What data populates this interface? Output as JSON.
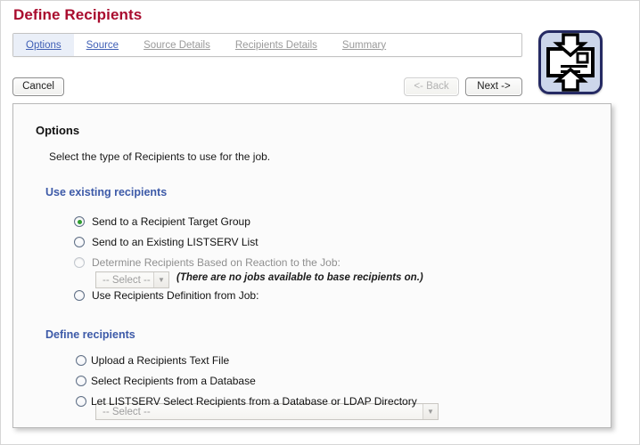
{
  "page": {
    "title": "Define Recipients"
  },
  "tabs": [
    {
      "label": "Options",
      "state": "active"
    },
    {
      "label": "Source",
      "state": "enabled"
    },
    {
      "label": "Source Details",
      "state": "disabled"
    },
    {
      "label": "Recipients Details",
      "state": "disabled"
    },
    {
      "label": "Summary",
      "state": "disabled"
    }
  ],
  "toolbar": {
    "cancel_label": "Cancel",
    "back_label": "<- Back",
    "next_label": "Next ->",
    "back_enabled": false,
    "next_enabled": true,
    "wizard_icon": "recipients-import-icon"
  },
  "content": {
    "section_title": "Options",
    "intro_text": "Select the type of Recipients to use for the job.",
    "groups": [
      {
        "heading": "Use existing recipients",
        "options": [
          {
            "label": "Send to a Recipient Target Group",
            "checked": true,
            "disabled": false
          },
          {
            "label": "Send to an Existing LISTSERV List",
            "checked": false,
            "disabled": false
          },
          {
            "label": "Determine Recipients Based on Reaction to the Job:",
            "checked": false,
            "disabled": true,
            "select": {
              "value": "-- Select --",
              "disabled": true,
              "arrow_icon": "chevron-down-icon"
            },
            "hint": "(There are no jobs available to base recipients on.)"
          },
          {
            "label": "Use Recipients Definition from Job:",
            "checked": false,
            "disabled": false,
            "select": {
              "value": "-- Select --",
              "disabled": false,
              "arrow_icon": "chevron-down-icon"
            }
          }
        ]
      },
      {
        "heading": "Define recipients",
        "options": [
          {
            "label": "Upload a Recipients Text File",
            "checked": false,
            "disabled": false
          },
          {
            "label": "Select Recipients from a Database",
            "checked": false,
            "disabled": false
          },
          {
            "label": "Let LISTSERV Select Recipients from a Database or LDAP Directory",
            "checked": false,
            "disabled": false
          }
        ]
      }
    ]
  },
  "colors": {
    "title_red": "#a90c2e",
    "group_heading_blue": "#3d5aa8",
    "tab_link_blue": "#3f5fb5",
    "tab_disabled_grey": "#9a9a9a",
    "radio_selected_green": "#2f9c2f",
    "icon_border_navy": "#252a63",
    "icon_fill_blue": "#ccd6ea"
  }
}
